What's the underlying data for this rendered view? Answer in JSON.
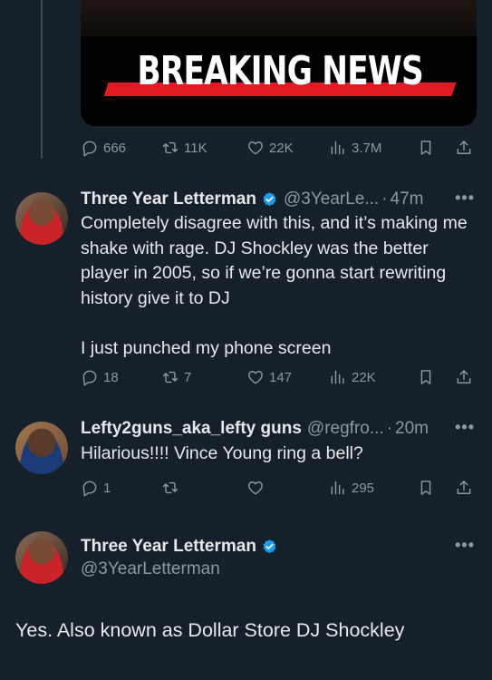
{
  "top_post": {
    "media_text": "BREAKING NEWS",
    "stats": {
      "replies": "666",
      "reposts": "11K",
      "likes": "22K",
      "views": "3.7M"
    }
  },
  "reply1": {
    "name": "Three Year Letterman",
    "handle": "@3YearLe...",
    "time": "47m",
    "text": "Completely disagree with this, and it’s making me shake with rage. DJ Shockley was the better player in 2005, so if we’re gonna start rewriting history give it to DJ\n\nI just punched my phone screen",
    "stats": {
      "replies": "18",
      "reposts": "7",
      "likes": "147",
      "views": "22K"
    }
  },
  "reply2": {
    "name": "Lefty2guns_aka_lefty guns",
    "handle": "@regfro...",
    "time": "20m",
    "text": "Hilarious!!!! Vince Young ring a bell?",
    "stats": {
      "replies": "1",
      "reposts": "",
      "likes": "",
      "views": "295"
    }
  },
  "main_post": {
    "name": "Three Year Letterman",
    "handle": "@3YearLetterman",
    "text": "Yes. Also known as Dollar Store DJ Shockley"
  },
  "ui": {
    "dot": "·",
    "more": "•••"
  },
  "colors": {
    "background": "#15202b",
    "muted": "#8b98a5",
    "verified": "#1d9bf0",
    "breaking_red": "#e01b22"
  },
  "icons": [
    "reply-icon",
    "repost-icon",
    "like-icon",
    "views-icon",
    "bookmark-icon",
    "share-icon",
    "verified-icon",
    "more-icon"
  ]
}
